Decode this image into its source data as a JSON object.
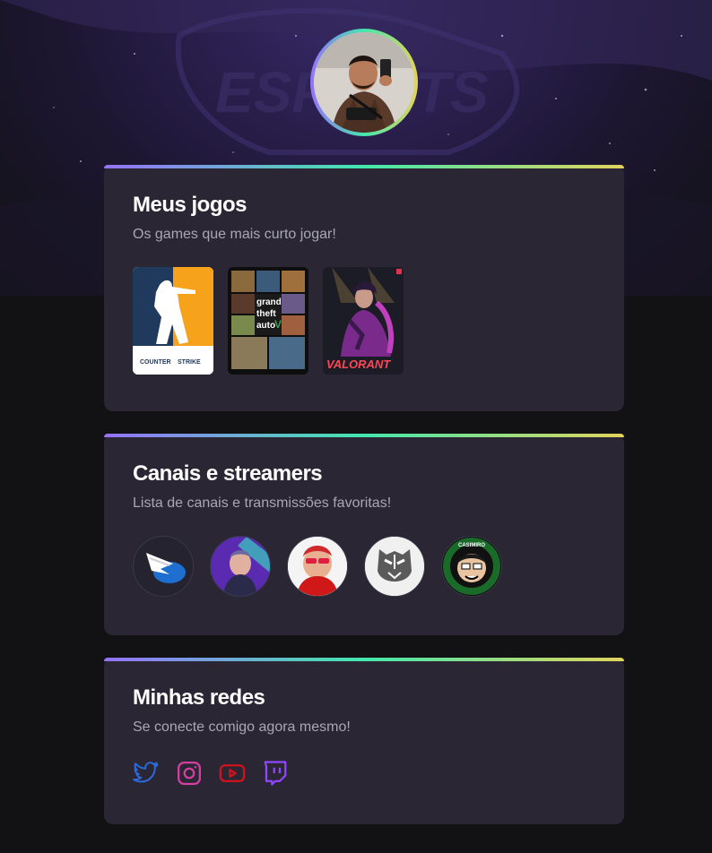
{
  "profile": {
    "avatar_alt": "profile-photo"
  },
  "games_section": {
    "title": "Meus jogos",
    "subtitle": "Os games que mais curto jogar!",
    "games": [
      {
        "name": "counter-strike",
        "logo_text_1": "COUNTER",
        "logo_text_2": "STRIKE"
      },
      {
        "name": "gta-v",
        "logo_text_1": "grand",
        "logo_text_2": "theft",
        "logo_text_3": "auto"
      },
      {
        "name": "valorant",
        "logo_text": "VALORANT"
      }
    ]
  },
  "channels_section": {
    "title": "Canais e streamers",
    "subtitle": "Lista de canais e transmissões favoritas!",
    "channels": [
      {
        "name": "channel-1-wing"
      },
      {
        "name": "channel-2-streamer"
      },
      {
        "name": "channel-3-streamer"
      },
      {
        "name": "channel-4-tiger"
      },
      {
        "name": "channel-5-casimiro",
        "badge_text": "CASIMIRO"
      }
    ]
  },
  "socials_section": {
    "title": "Minhas redes",
    "subtitle": "Se conecte comigo agora mesmo!",
    "socials": [
      {
        "icon": "twitter-icon",
        "color": "#2a6bdc"
      },
      {
        "icon": "instagram-icon",
        "color": "#d43fa0"
      },
      {
        "icon": "youtube-icon",
        "color": "#d3131b"
      },
      {
        "icon": "twitch-icon",
        "color": "#9146ff"
      }
    ]
  },
  "colors": {
    "background": "#121214",
    "card": "#2a2634",
    "gradient": [
      "#9572fc",
      "#43e7ad",
      "#e2d45c"
    ],
    "subtitle": "#a8a8b3"
  }
}
